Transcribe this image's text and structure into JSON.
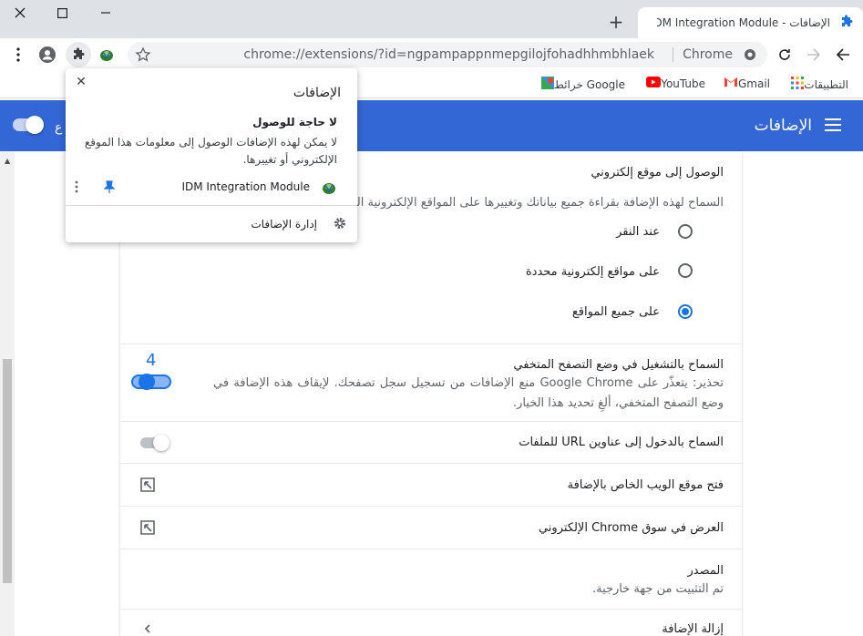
{
  "tab": {
    "title": "الإضافات - IDM Integration Module"
  },
  "toolbar": {
    "url": "chrome://extensions/?id=ngpampappnmepgilojfohadhhmbhlaek",
    "chip": "Chrome"
  },
  "bookmarks": [
    {
      "label": "التطبيقات",
      "icon": "apps-grid-icon"
    },
    {
      "label": "Gmail",
      "icon": "gmail-icon"
    },
    {
      "label": "YouTube",
      "icon": "youtube-icon"
    },
    {
      "label": "خرائط Google",
      "icon": "maps-icon"
    }
  ],
  "header": {
    "title": "الإضافات",
    "dev_mode_label": "ع"
  },
  "popup": {
    "title": "الإضافات",
    "subtitle": "لا حاجة للوصول",
    "description": "لا يمكن لهذه الإضافات الوصول إلى معلومات هذا الموقع الإلكتروني أو تغييرها.",
    "extension_name": "IDM Integration Module",
    "manage_label": "إدارة الإضافات"
  },
  "site_access": {
    "title": "الوصول إلى موقع إلكتروني",
    "description": "السماح لهذه الإضافة بقراءة جميع بياناتك وتغييرها على المواقع الإلكترونية التي",
    "options": [
      {
        "label": "عند النقر",
        "selected": false
      },
      {
        "label": "على مواقع إلكترونية محددة",
        "selected": false
      },
      {
        "label": "على جميع المواقع",
        "selected": true
      }
    ]
  },
  "incognito": {
    "title": "السماح بالتشغيل في وضع التصفح المتخفي",
    "warning": "تحذير: يتعذّر على Google Chrome منع الإضافات من تسجيل سجل تصفحك. لإيقاف هذه الإضافة في وضع التصفح المتخفي، ألغِ تحديد هذا الخيار.",
    "enabled": true,
    "annotation": "4"
  },
  "file_urls": {
    "title": "السماح بالدخول إلى عناوين URL للملفات",
    "enabled": false
  },
  "website": {
    "title": "فتح موقع الويب الخاص بالإضافة"
  },
  "webstore": {
    "title": "العرض في سوق Chrome الإلكتروني"
  },
  "source": {
    "title": "المصدر",
    "value": "تم التثبيت من جهة خارجية."
  },
  "remove": {
    "title": "إزالة الإضافة"
  }
}
